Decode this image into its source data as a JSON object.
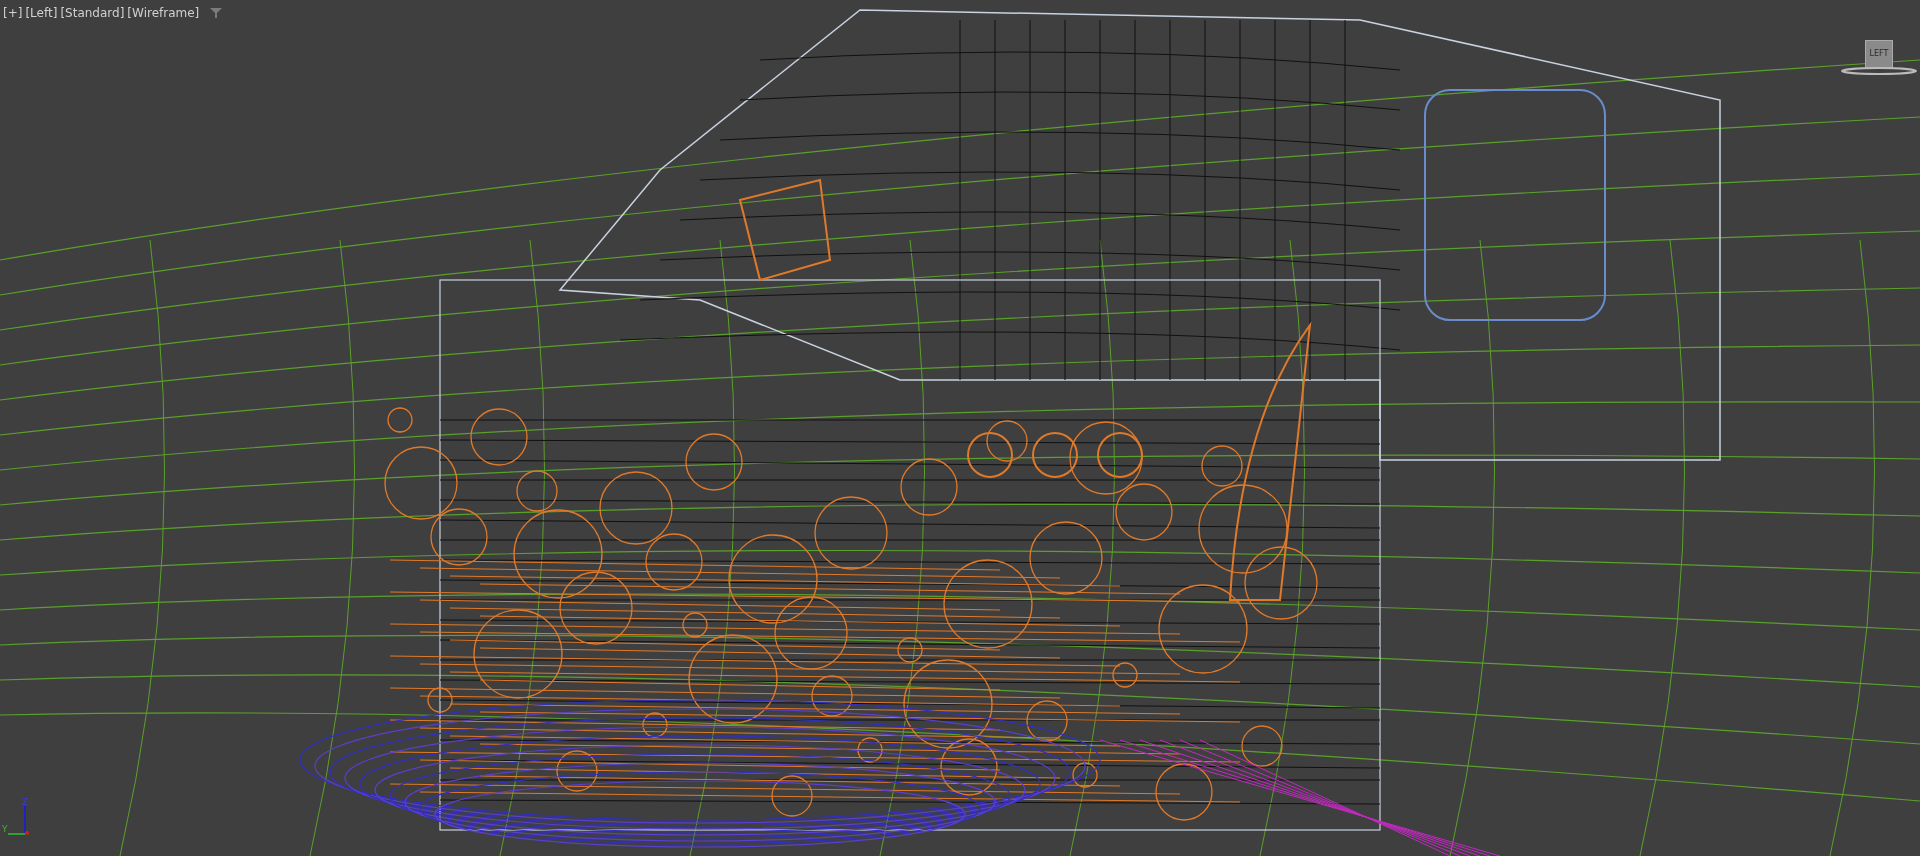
{
  "viewport": {
    "labels": [
      {
        "text": "[+]"
      },
      {
        "text": "[Left]"
      },
      {
        "text": "[Standard]"
      },
      {
        "text": "[Wireframe]"
      }
    ],
    "view_cube": {
      "label": "LEFT"
    },
    "axis_gizmo": {
      "labels": [
        "Z",
        "Y"
      ]
    }
  }
}
